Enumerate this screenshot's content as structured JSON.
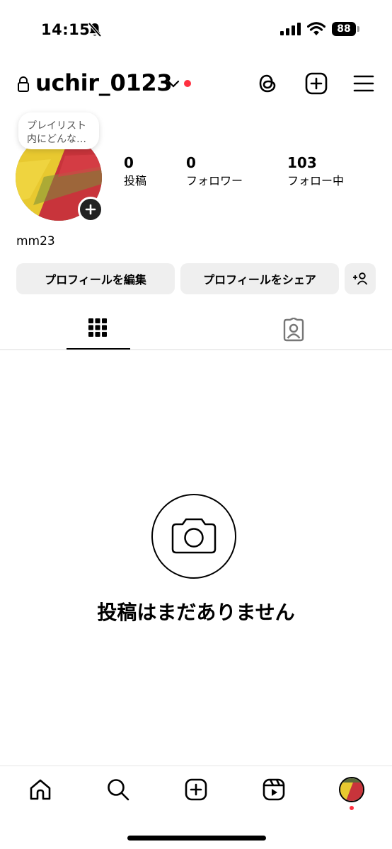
{
  "status_bar": {
    "time": "14:15",
    "battery": "88",
    "icons": [
      "bell-slash-icon",
      "signal-icon",
      "wifi-icon",
      "battery-icon"
    ]
  },
  "header": {
    "username": "uchir_0123",
    "icons": [
      "lock-icon",
      "chevron-down-icon",
      "threads-icon",
      "create-post-icon",
      "menu-icon"
    ],
    "notification_dot_color": "#ff3040"
  },
  "profile": {
    "note": {
      "line1": "プレイリスト",
      "line2": "内にどんな…"
    },
    "stats": [
      {
        "value": "0",
        "label": "投稿"
      },
      {
        "value": "0",
        "label": "フォロワー"
      },
      {
        "value": "103",
        "label": "フォロー中"
      }
    ],
    "display_name": "mm23",
    "buttons": {
      "edit": "プロフィールを編集",
      "share": "プロフィールをシェア"
    }
  },
  "tabs": [
    "grid-icon",
    "tagged-icon"
  ],
  "empty_state": {
    "icon": "camera-icon",
    "text": "投稿はまだありません"
  },
  "bottom_nav": [
    "home-icon",
    "search-icon",
    "create-icon",
    "reels-icon",
    "profile-avatar"
  ]
}
